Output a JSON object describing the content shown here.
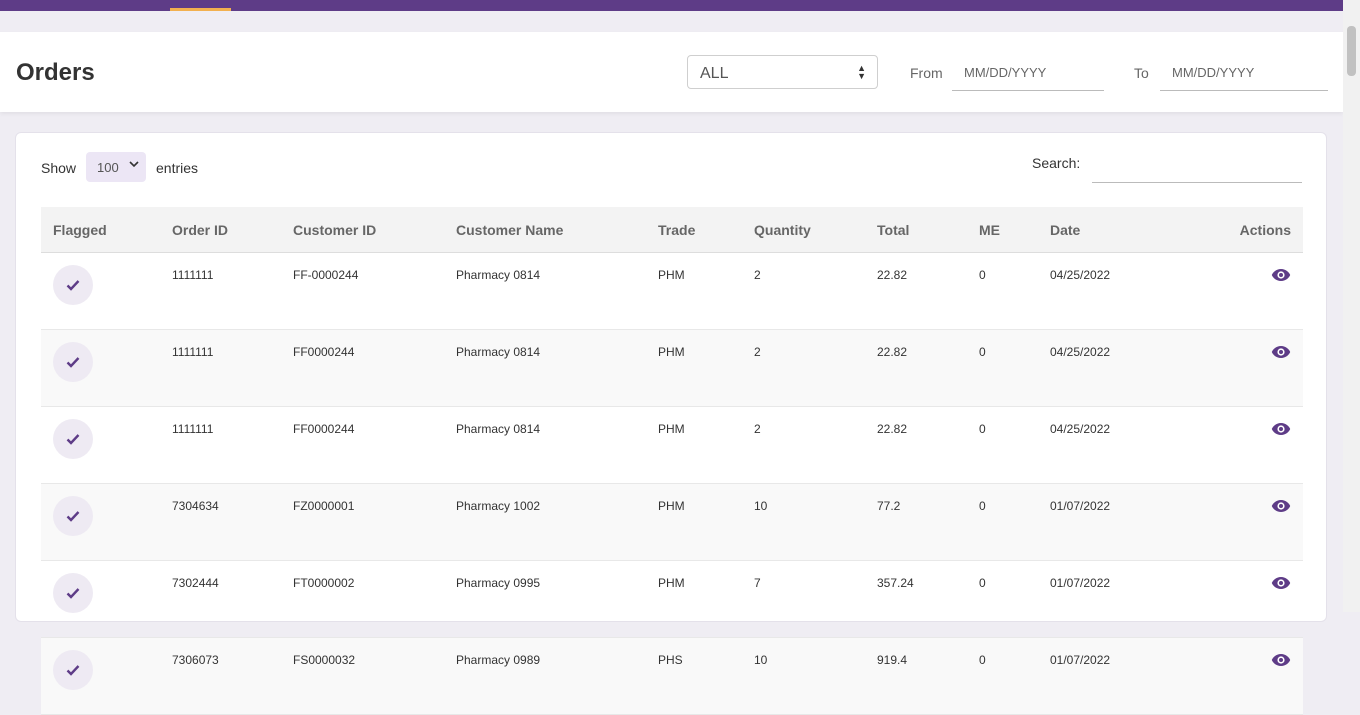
{
  "header": {
    "title": "Orders",
    "status_filter": "ALL",
    "from_label": "From",
    "from_placeholder": "MM/DD/YYYY",
    "to_label": "To",
    "to_placeholder": "MM/DD/YYYY"
  },
  "table_controls": {
    "show_label": "Show",
    "page_length": "100",
    "entries_label": "entries",
    "search_label": "Search:"
  },
  "columns": [
    "Flagged",
    "Order ID",
    "Customer ID",
    "Customer Name",
    "Trade",
    "Quantity",
    "Total",
    "ME",
    "Date",
    "Actions"
  ],
  "rows": [
    {
      "order_id": "1111111",
      "customer_id": "FF-0000244",
      "customer_name": "Pharmacy 0814",
      "trade": "PHM",
      "quantity": "2",
      "total": "22.82",
      "me": "0",
      "date": "04/25/2022"
    },
    {
      "order_id": "1111111",
      "customer_id": "FF0000244",
      "customer_name": "Pharmacy 0814",
      "trade": "PHM",
      "quantity": "2",
      "total": "22.82",
      "me": "0",
      "date": "04/25/2022"
    },
    {
      "order_id": "1111111",
      "customer_id": "FF0000244",
      "customer_name": "Pharmacy 0814",
      "trade": "PHM",
      "quantity": "2",
      "total": "22.82",
      "me": "0",
      "date": "04/25/2022"
    },
    {
      "order_id": "7304634",
      "customer_id": "FZ0000001",
      "customer_name": "Pharmacy 1002",
      "trade": "PHM",
      "quantity": "10",
      "total": "77.2",
      "me": "0",
      "date": "01/07/2022"
    },
    {
      "order_id": "7302444",
      "customer_id": "FT0000002",
      "customer_name": "Pharmacy 0995",
      "trade": "PHM",
      "quantity": "7",
      "total": "357.24",
      "me": "0",
      "date": "01/07/2022"
    },
    {
      "order_id": "7306073",
      "customer_id": "FS0000032",
      "customer_name": "Pharmacy 0989",
      "trade": "PHS",
      "quantity": "10",
      "total": "919.4",
      "me": "0",
      "date": "01/07/2022"
    }
  ],
  "icons": {
    "flag": "check-icon",
    "action": "eye-icon"
  },
  "colors": {
    "brand": "#5e3c87",
    "accent": "#f2b04f",
    "flag_bg": "#eeeaf3"
  }
}
